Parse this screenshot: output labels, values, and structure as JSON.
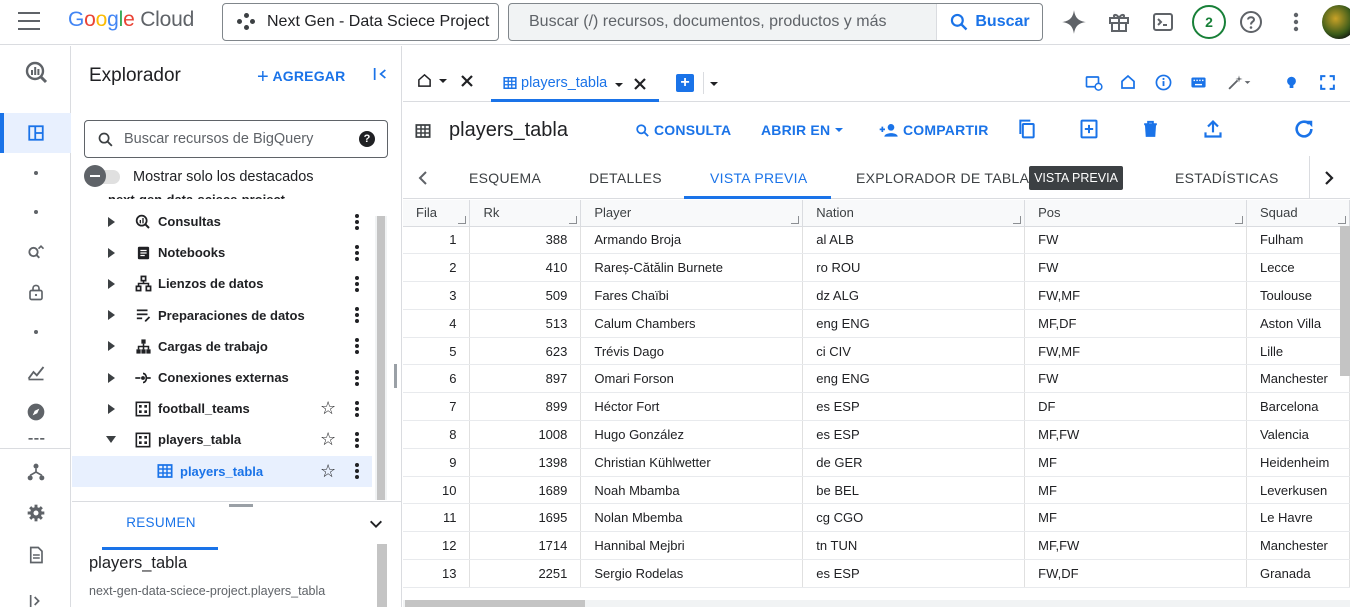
{
  "header": {
    "logo_google": "Google",
    "logo_cloud": "Cloud",
    "project": "Next Gen - Data Sciece Project",
    "search_placeholder": "Buscar (/) recursos, documentos, productos y más",
    "search_button": "Buscar",
    "notifications_count": "2",
    "colors": {
      "google_blue": "#4285f4",
      "google_red": "#ea4335",
      "google_yellow": "#fbbc05",
      "google_green": "#34a853",
      "accent": "#1a73e8"
    }
  },
  "rail_icons": [
    "bigquery-logo-icon",
    "studio-icon",
    "dot-icon",
    "dot-icon",
    "search-analytics-icon",
    "lock-icon",
    "dot-icon",
    "chart-icon",
    "compass-icon",
    "grid-icon",
    "hierarchy-icon",
    "settings-icon",
    "document-icon",
    "expand-icon"
  ],
  "explorer": {
    "title": "Explorador",
    "add_label": "AGREGAR",
    "search_placeholder": "Buscar recursos de BigQuery",
    "toggle_label": "Mostrar solo los destacados",
    "partial_row": "next-gen-data-sciece-project",
    "tree": [
      {
        "label": "Consultas",
        "icon": "query-icon",
        "star": false
      },
      {
        "label": "Notebooks",
        "icon": "notebook-icon",
        "star": false
      },
      {
        "label": "Lienzos de datos",
        "icon": "canvas-icon",
        "star": false
      },
      {
        "label": "Preparaciones de datos",
        "icon": "data-prep-icon",
        "star": false
      },
      {
        "label": "Cargas de trabajo",
        "icon": "workload-icon",
        "star": false
      },
      {
        "label": "Conexiones externas",
        "icon": "external-connection-icon",
        "star": false
      },
      {
        "label": "football_teams",
        "icon": "dataset-icon",
        "star": true
      },
      {
        "label": "players_tabla",
        "icon": "dataset-icon",
        "star": true,
        "expanded": true
      },
      {
        "label": "players_tabla",
        "icon": "table-icon",
        "star": true,
        "selected": true
      }
    ],
    "resumen_tab": "RESUMEN",
    "resumen_title": "players_tabla",
    "resumen_sub": "next-gen-data-sciece-project.players_tabla"
  },
  "main": {
    "tab_label": "players_tabla",
    "title": "players_tabla",
    "actions": {
      "consulta": "CONSULTA",
      "abrir_en": "ABRIR EN",
      "compartir": "COMPARTIR"
    },
    "subtabs": [
      "ESQUEMA",
      "DETALLES",
      "VISTA PREVIA",
      "EXPLORADOR DE TABLAS",
      "ESTADÍSTICAS"
    ],
    "tooltip": "VISTA PREVIA",
    "table": {
      "columns": [
        "Fila",
        "Rk",
        "Player",
        "Nation",
        "Pos",
        "Squad"
      ],
      "rows": [
        [
          "1",
          "388",
          "Armando Broja",
          "al ALB",
          "FW",
          "Fulham"
        ],
        [
          "2",
          "410",
          "Rareș-Cătălin Burnete",
          "ro ROU",
          "FW",
          "Lecce"
        ],
        [
          "3",
          "509",
          "Fares Chaïbi",
          "dz ALG",
          "FW,MF",
          "Toulouse"
        ],
        [
          "4",
          "513",
          "Calum Chambers",
          "eng ENG",
          "MF,DF",
          "Aston Villa"
        ],
        [
          "5",
          "623",
          "Trévis Dago",
          "ci CIV",
          "FW,MF",
          "Lille"
        ],
        [
          "6",
          "897",
          "Omari Forson",
          "eng ENG",
          "FW",
          "Manchester"
        ],
        [
          "7",
          "899",
          "Héctor Fort",
          "es ESP",
          "DF",
          "Barcelona"
        ],
        [
          "8",
          "1008",
          "Hugo González",
          "es ESP",
          "MF,FW",
          "Valencia"
        ],
        [
          "9",
          "1398",
          "Christian Kühlwetter",
          "de GER",
          "MF",
          "Heidenheim"
        ],
        [
          "10",
          "1689",
          "Noah Mbamba",
          "be BEL",
          "MF",
          "Leverkusen"
        ],
        [
          "11",
          "1695",
          "Nolan Mbemba",
          "cg CGO",
          "MF",
          "Le Havre"
        ],
        [
          "12",
          "1714",
          "Hannibal Mejbri",
          "tn TUN",
          "MF,FW",
          "Manchester"
        ],
        [
          "13",
          "2251",
          "Sergio Rodelas",
          "es ESP",
          "FW,DF",
          "Granada"
        ]
      ]
    }
  }
}
